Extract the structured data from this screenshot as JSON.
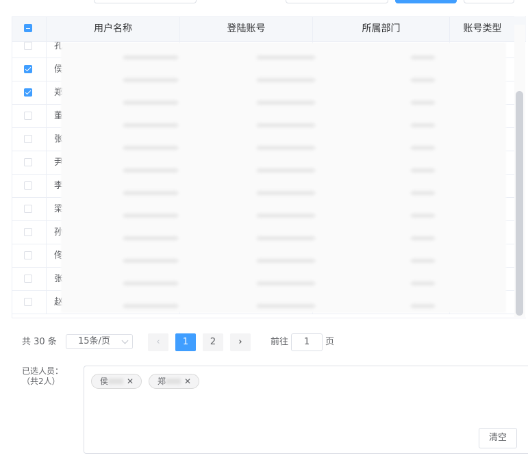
{
  "colors": {
    "primary": "#409eff",
    "border": "#dcdfe6",
    "header_bg": "#f5f7fa",
    "text": "#606266"
  },
  "table": {
    "columns": [
      "用户名称",
      "登陆账号",
      "所属部门",
      "账号类型"
    ],
    "header_checkbox": "indeterminate",
    "rows": [
      {
        "name_prefix": "孔",
        "checked": false
      },
      {
        "name_prefix": "侯",
        "checked": true
      },
      {
        "name_prefix": "郑",
        "checked": true
      },
      {
        "name_prefix": "董",
        "checked": false
      },
      {
        "name_prefix": "张",
        "checked": false
      },
      {
        "name_prefix": "尹",
        "checked": false
      },
      {
        "name_prefix": "李",
        "checked": false
      },
      {
        "name_prefix": "梁",
        "checked": false
      },
      {
        "name_prefix": "孙",
        "checked": false
      },
      {
        "name_prefix": "佟",
        "checked": false
      },
      {
        "name_prefix": "张",
        "checked": false
      },
      {
        "name_prefix": "赵",
        "checked": false
      }
    ]
  },
  "pagination": {
    "total_text": "共 30 条",
    "page_size": "15条/页",
    "pages": [
      "1",
      "2"
    ],
    "current_page": "1",
    "goto_prefix": "前往",
    "goto_value": "1",
    "goto_suffix": "页",
    "prev_icon": "chevron-left-icon",
    "next_icon": "chevron-right-icon"
  },
  "selected": {
    "label_line1": "已选人员：",
    "label_line2": "（共2人）",
    "tags": [
      {
        "name_prefix": "侯"
      },
      {
        "name_prefix": "郑"
      }
    ],
    "clear_label": "清空"
  }
}
